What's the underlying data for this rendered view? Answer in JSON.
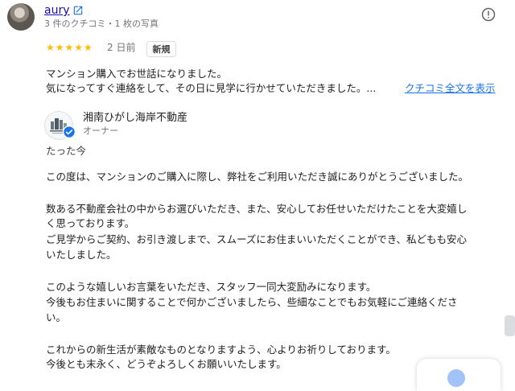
{
  "reviewer": {
    "name": "aury",
    "meta": "3 件のクチコミ・1 枚の写真"
  },
  "rating": {
    "stars": 5,
    "stars_text": "★★★★★",
    "date": "2 日前",
    "badge": "新規"
  },
  "review": {
    "line1": "マンション購入でお世話になりました。",
    "line2": "気になってすぐ連絡をして、その日に見学に行かせていただきました。...",
    "read_more": "クチコミ全文を表示"
  },
  "owner": {
    "name": "湘南ひがし海岸不動産",
    "role": "オーナー",
    "reply_time": "たった今"
  },
  "reply": {
    "p1": "この度は、マンションのご購入に際し、弊社をご利用いただき誠にありがとうございました。",
    "p2a": "数ある不動産会社の中からお選びいただき、また、安心してお任せいただけたことを大変嬉し",
    "p2b": "く思っております。",
    "p3a": "ご見学からご契約、お引き渡しまで、スムーズにお住まいいただくことができ、私どもも安心",
    "p3b": "いたしました。",
    "p4a": "このような嬉しいお言葉をいただき、スタッフ一同大変励みになります。",
    "p4b": "今後もお住まいに関することで何かございましたら、些細なことでもお気軽にご連絡くださ",
    "p4c": "い。",
    "p5a": "これからの新生活が素敵なものとなりますよう、心よりお祈りしております。",
    "p5b": "今後とも末永く、どうぞよろしくお願いいたします。"
  },
  "colors": {
    "link": "#1a0dab",
    "accent_blue": "#1a73e8",
    "star": "#fbbc04",
    "muted_text": "#70757a"
  },
  "icons": [
    "external-link-icon",
    "report-icon",
    "verified-badge-icon"
  ]
}
